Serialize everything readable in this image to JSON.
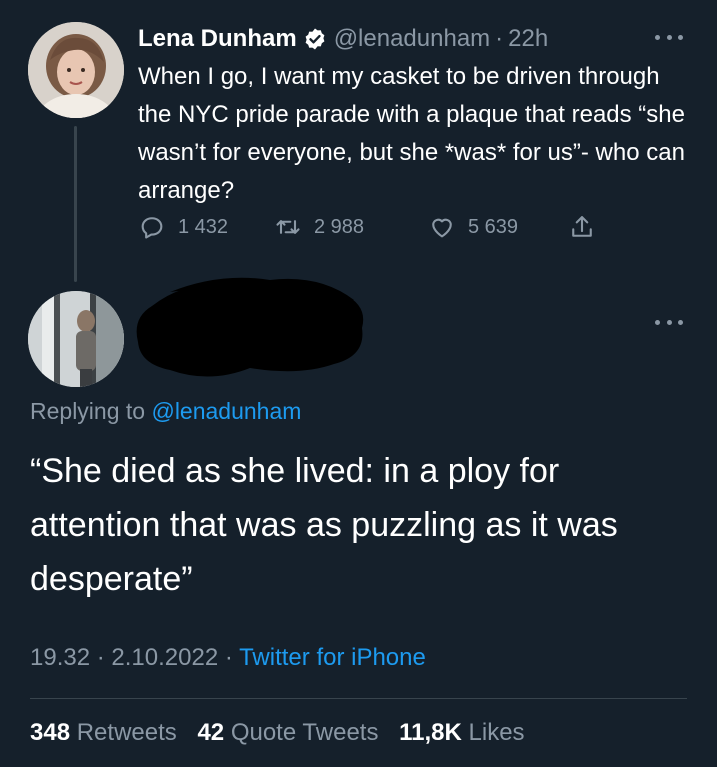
{
  "tweet": {
    "author_name": "Lena Dunham",
    "handle": "@lenadunham",
    "separator": "·",
    "time": "22h",
    "text": "When I go, I want my casket to be driven through the NYC pride parade with a plaque that reads “she wasn’t for everyone, but she *was* for us”- who can arrange?",
    "reply_count": "1 432",
    "retweet_count": "2 988",
    "like_count": "5 639"
  },
  "reply": {
    "replying_to_label": "Replying to",
    "replying_to_handle": "@lenadunham",
    "text": "“She died as she lived: in a ploy for attention that was as puzzling as it was desperate”",
    "time": "19.32",
    "separator1": "·",
    "date": "2.10.2022",
    "separator2": "·",
    "source": "Twitter for iPhone",
    "retweets_count": "348",
    "retweets_label": "Retweets",
    "quote_count": "42",
    "quote_label": "Quote Tweets",
    "likes_count": "11,8K",
    "likes_label": "Likes"
  },
  "colors": {
    "background": "#15202b",
    "muted_text": "#8b98a5",
    "link": "#1d9bf0",
    "divider": "#38444d"
  },
  "icons": {
    "verified": "verified-badge-icon",
    "reply": "speech-bubble-icon",
    "retweet": "retweet-arrows-icon",
    "like": "heart-icon",
    "share": "share-upload-icon",
    "more": "ellipsis-icon"
  }
}
